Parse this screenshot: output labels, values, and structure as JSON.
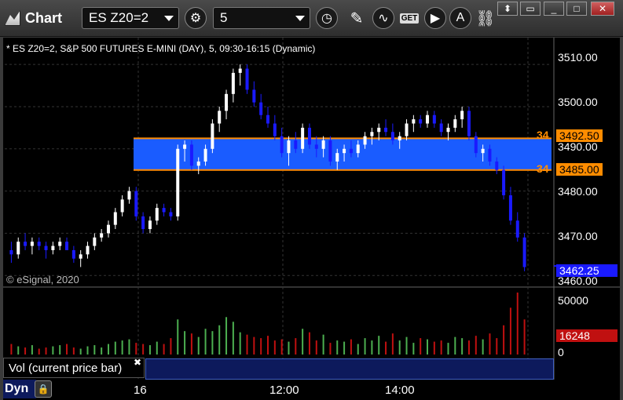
{
  "toolbar": {
    "title": "Chart",
    "symbol": "ES Z20=2",
    "interval": "5",
    "icons": [
      "gear-icon",
      "clock-icon",
      "pencil-icon",
      "study-icon",
      "get-icon",
      "play-icon",
      "alert-icon",
      "link-icon"
    ],
    "window_buttons": [
      "pin",
      "restore",
      "maximize",
      "close"
    ],
    "get_label": "GET"
  },
  "legend": "* ES Z20=2, S&P 500 FUTURES E-MINI (DAY), 5, 09:30-16:15 (Dynamic)",
  "copyright": "© eSignal, 2020",
  "price_axis": {
    "ticks": [
      "3510.00",
      "3500.00",
      "3490.00",
      "3480.00",
      "3470.00",
      "3460.00"
    ],
    "current_price": "3462.25",
    "zone_top": "3492.50",
    "zone_bottom": "3485.00",
    "zone_top_edge": "34",
    "zone_bottom_edge": "34"
  },
  "volume_axis": {
    "ticks": [
      "50000",
      "0"
    ],
    "current_volume": "16248"
  },
  "volume_title": "Vol (current price bar)",
  "bottom": {
    "dyn_label": "Dyn",
    "times": [
      "16",
      "12:00",
      "14:00"
    ]
  },
  "colors": {
    "up_candle": "#ffffff",
    "down_candle": "#1a1aff",
    "zone_fill": "#1a5cff",
    "zone_line": "#ff8c00",
    "vol_up": "#4caf50",
    "vol_down": "#c01010",
    "current_price_bg": "#1a1aff",
    "current_volume_bg": "#c01010"
  },
  "chart_data": {
    "type": "candlestick",
    "price_range": [
      3458,
      3513
    ],
    "zone": [
      3485.0,
      3492.5
    ],
    "candles": [
      [
        3466,
        3468,
        3463,
        3465
      ],
      [
        3465,
        3469,
        3464,
        3468
      ],
      [
        3468,
        3470,
        3466,
        3467
      ],
      [
        3467,
        3469,
        3465,
        3468
      ],
      [
        3468,
        3469,
        3466,
        3467
      ],
      [
        3467,
        3468,
        3464,
        3466
      ],
      [
        3466,
        3468,
        3465,
        3467
      ],
      [
        3467,
        3469,
        3466,
        3468
      ],
      [
        3468,
        3469,
        3466,
        3466
      ],
      [
        3466,
        3467,
        3463,
        3464
      ],
      [
        3464,
        3466,
        3462,
        3465
      ],
      [
        3465,
        3468,
        3464,
        3467
      ],
      [
        3467,
        3470,
        3466,
        3469
      ],
      [
        3469,
        3471,
        3468,
        3470
      ],
      [
        3470,
        3473,
        3469,
        3472
      ],
      [
        3472,
        3476,
        3471,
        3475
      ],
      [
        3475,
        3479,
        3474,
        3478
      ],
      [
        3478,
        3481,
        3477,
        3480
      ],
      [
        3480,
        3481,
        3473,
        3474
      ],
      [
        3474,
        3475,
        3470,
        3471
      ],
      [
        3471,
        3474,
        3470,
        3473
      ],
      [
        3473,
        3477,
        3472,
        3476
      ],
      [
        3476,
        3477,
        3474,
        3475
      ],
      [
        3475,
        3476,
        3473,
        3474
      ],
      [
        3474,
        3491,
        3473,
        3490
      ],
      [
        3490,
        3492,
        3487,
        3491
      ],
      [
        3491,
        3492,
        3485,
        3486
      ],
      [
        3486,
        3488,
        3484,
        3487
      ],
      [
        3487,
        3491,
        3486,
        3490
      ],
      [
        3490,
        3497,
        3489,
        3496
      ],
      [
        3496,
        3500,
        3494,
        3499
      ],
      [
        3499,
        3504,
        3497,
        3503
      ],
      [
        3503,
        3509,
        3501,
        3508
      ],
      [
        3508,
        3510,
        3505,
        3509
      ],
      [
        3509,
        3510,
        3503,
        3504
      ],
      [
        3504,
        3506,
        3500,
        3501
      ],
      [
        3501,
        3503,
        3497,
        3498
      ],
      [
        3498,
        3500,
        3495,
        3496
      ],
      [
        3496,
        3498,
        3492,
        3493
      ],
      [
        3493,
        3495,
        3488,
        3489
      ],
      [
        3489,
        3493,
        3486,
        3492
      ],
      [
        3492,
        3494,
        3489,
        3490
      ],
      [
        3490,
        3496,
        3489,
        3495
      ],
      [
        3495,
        3496,
        3490,
        3491
      ],
      [
        3491,
        3493,
        3488,
        3490
      ],
      [
        3490,
        3493,
        3488,
        3492
      ],
      [
        3492,
        3493,
        3486,
        3487
      ],
      [
        3487,
        3490,
        3485,
        3489
      ],
      [
        3489,
        3491,
        3487,
        3490
      ],
      [
        3490,
        3492,
        3488,
        3489
      ],
      [
        3489,
        3492,
        3488,
        3491
      ],
      [
        3491,
        3494,
        3490,
        3493
      ],
      [
        3493,
        3495,
        3491,
        3494
      ],
      [
        3494,
        3496,
        3492,
        3495
      ],
      [
        3495,
        3497,
        3493,
        3494
      ],
      [
        3494,
        3496,
        3491,
        3492
      ],
      [
        3492,
        3494,
        3490,
        3493
      ],
      [
        3493,
        3497,
        3492,
        3496
      ],
      [
        3496,
        3498,
        3494,
        3497
      ],
      [
        3497,
        3498,
        3495,
        3496
      ],
      [
        3496,
        3499,
        3495,
        3498
      ],
      [
        3498,
        3499,
        3495,
        3496
      ],
      [
        3496,
        3497,
        3493,
        3494
      ],
      [
        3494,
        3496,
        3492,
        3495
      ],
      [
        3495,
        3498,
        3494,
        3497
      ],
      [
        3497,
        3500,
        3495,
        3499
      ],
      [
        3499,
        3500,
        3492,
        3493
      ],
      [
        3493,
        3494,
        3488,
        3489
      ],
      [
        3489,
        3491,
        3487,
        3490
      ],
      [
        3490,
        3491,
        3486,
        3487
      ],
      [
        3487,
        3488,
        3484,
        3485
      ],
      [
        3485,
        3486,
        3478,
        3479
      ],
      [
        3479,
        3481,
        3472,
        3473
      ],
      [
        3473,
        3475,
        3468,
        3469
      ],
      [
        3469,
        3470,
        3461,
        3462
      ]
    ],
    "volumes": [
      9000,
      7000,
      6000,
      8000,
      5000,
      6000,
      7000,
      8000,
      9000,
      6000,
      5000,
      7000,
      8000,
      6000,
      9000,
      11000,
      12000,
      13000,
      10000,
      9000,
      8000,
      11000,
      9000,
      14000,
      30000,
      20000,
      18000,
      15000,
      22000,
      20000,
      25000,
      32000,
      28000,
      19000,
      17000,
      15000,
      14000,
      16000,
      12000,
      13000,
      11000,
      14000,
      22000,
      19000,
      12000,
      17000,
      10000,
      12000,
      11000,
      13000,
      9000,
      14000,
      12000,
      16000,
      11000,
      18000,
      12000,
      15000,
      10000,
      14000,
      13000,
      11000,
      12000,
      10000,
      15000,
      14000,
      12000,
      16000,
      13000,
      18000,
      14000,
      25000,
      40000,
      53000,
      30000
    ],
    "volume_range": [
      0,
      55000
    ]
  }
}
